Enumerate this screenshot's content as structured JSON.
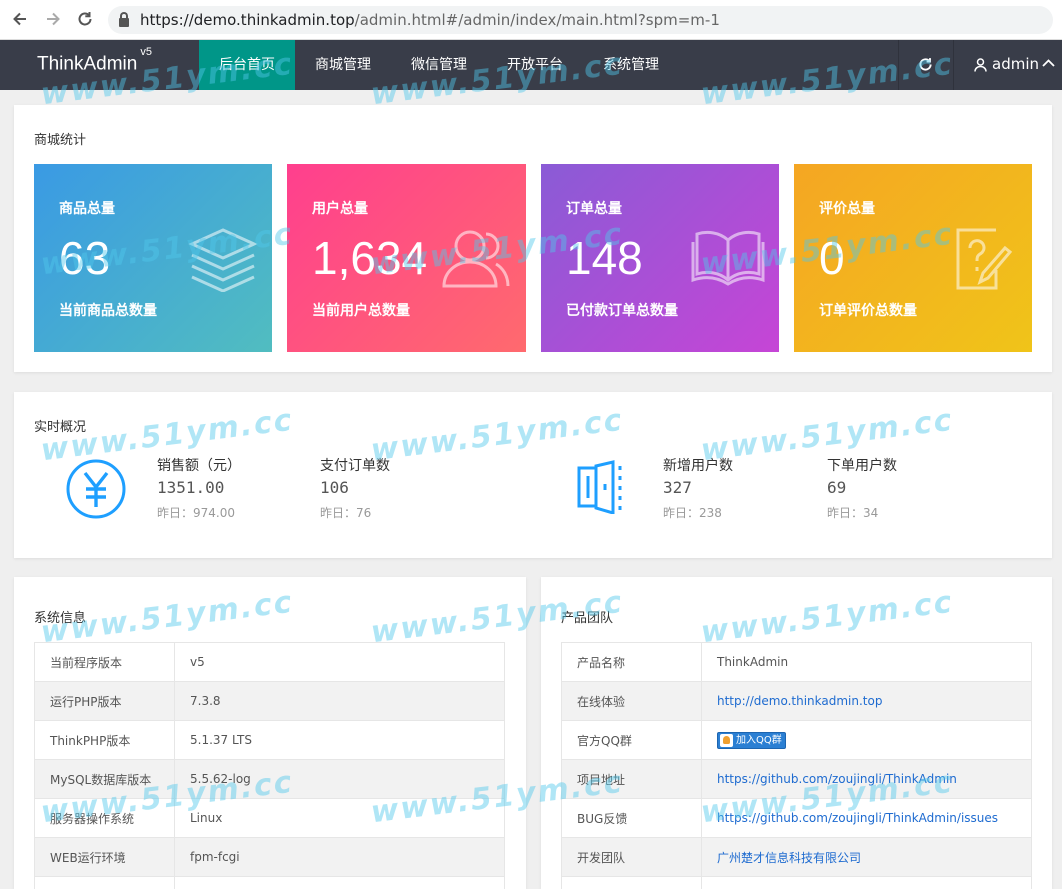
{
  "browser": {
    "url_main": "https://demo.thinkadmin.top",
    "url_rest": "/admin.html#/admin/index/main.html?spm=m-1"
  },
  "nav": {
    "logo": "ThinkAdmin",
    "logo_sup": "v5",
    "items": [
      "后台首页",
      "商城管理",
      "微信管理",
      "开放平台",
      "系统管理"
    ],
    "active_index": 0,
    "user": "admin"
  },
  "mall_stats": {
    "title": "商城统计",
    "cards": [
      {
        "title": "商品总量",
        "value": "63",
        "desc": "当前商品总数量",
        "icon": "layers-icon",
        "color_from": "#3a9ae4",
        "color_to": "#51bdc0"
      },
      {
        "title": "用户总量",
        "value": "1,634",
        "desc": "当前用户总数量",
        "icon": "users-icon",
        "color_from": "#ff3f8e",
        "color_to": "#ff6a6e"
      },
      {
        "title": "订单总量",
        "value": "148",
        "desc": "已付款订单总数量",
        "icon": "book-icon",
        "color_from": "#8a5bd6",
        "color_to": "#c645d6"
      },
      {
        "title": "评价总量",
        "value": "0",
        "desc": "订单评价总数量",
        "icon": "feedback-icon",
        "color_from": "#f5a623",
        "color_to": "#f0c419"
      }
    ]
  },
  "realtime": {
    "title": "实时概况",
    "items": [
      {
        "label": "销售额（元）",
        "value": "1351.00",
        "yesterday": "昨日：974.00"
      },
      {
        "label": "支付订单数",
        "value": "106",
        "yesterday": "昨日：76"
      },
      {
        "label": "新增用户数",
        "value": "327",
        "yesterday": "昨日：238"
      },
      {
        "label": "下单用户数",
        "value": "69",
        "yesterday": "昨日：34"
      }
    ]
  },
  "system_info": {
    "title": "系统信息",
    "rows": [
      {
        "k": "当前程序版本",
        "v": "v5"
      },
      {
        "k": "运行PHP版本",
        "v": "7.3.8"
      },
      {
        "k": "ThinkPHP版本",
        "v": "5.1.37 LTS"
      },
      {
        "k": "MySQL数据库版本",
        "v": "5.5.62-log"
      },
      {
        "k": "服务器操作系统",
        "v": "Linux"
      },
      {
        "k": "WEB运行环境",
        "v": "fpm-fcgi"
      }
    ]
  },
  "team": {
    "title": "产品团队",
    "rows": [
      {
        "k": "产品名称",
        "v": "ThinkAdmin"
      },
      {
        "k": "在线体验",
        "v": "http://demo.thinkadmin.top"
      },
      {
        "k": "官方QQ群",
        "v": "加入QQ群"
      },
      {
        "k": "项目地址",
        "v": "https://github.com/zoujingli/ThinkAdmin"
      },
      {
        "k": "BUG反馈",
        "v": "https://github.com/zoujingli/ThinkAdmin/issues"
      },
      {
        "k": "开发团队",
        "v": "广州楚才信息科技有限公司"
      }
    ]
  },
  "watermark": "www.51ym.cc",
  "colors": {
    "nav_bg": "#393d49",
    "accent": "#009688",
    "link": "#1e6bd0",
    "realtime_icon": "#1e9fff"
  }
}
